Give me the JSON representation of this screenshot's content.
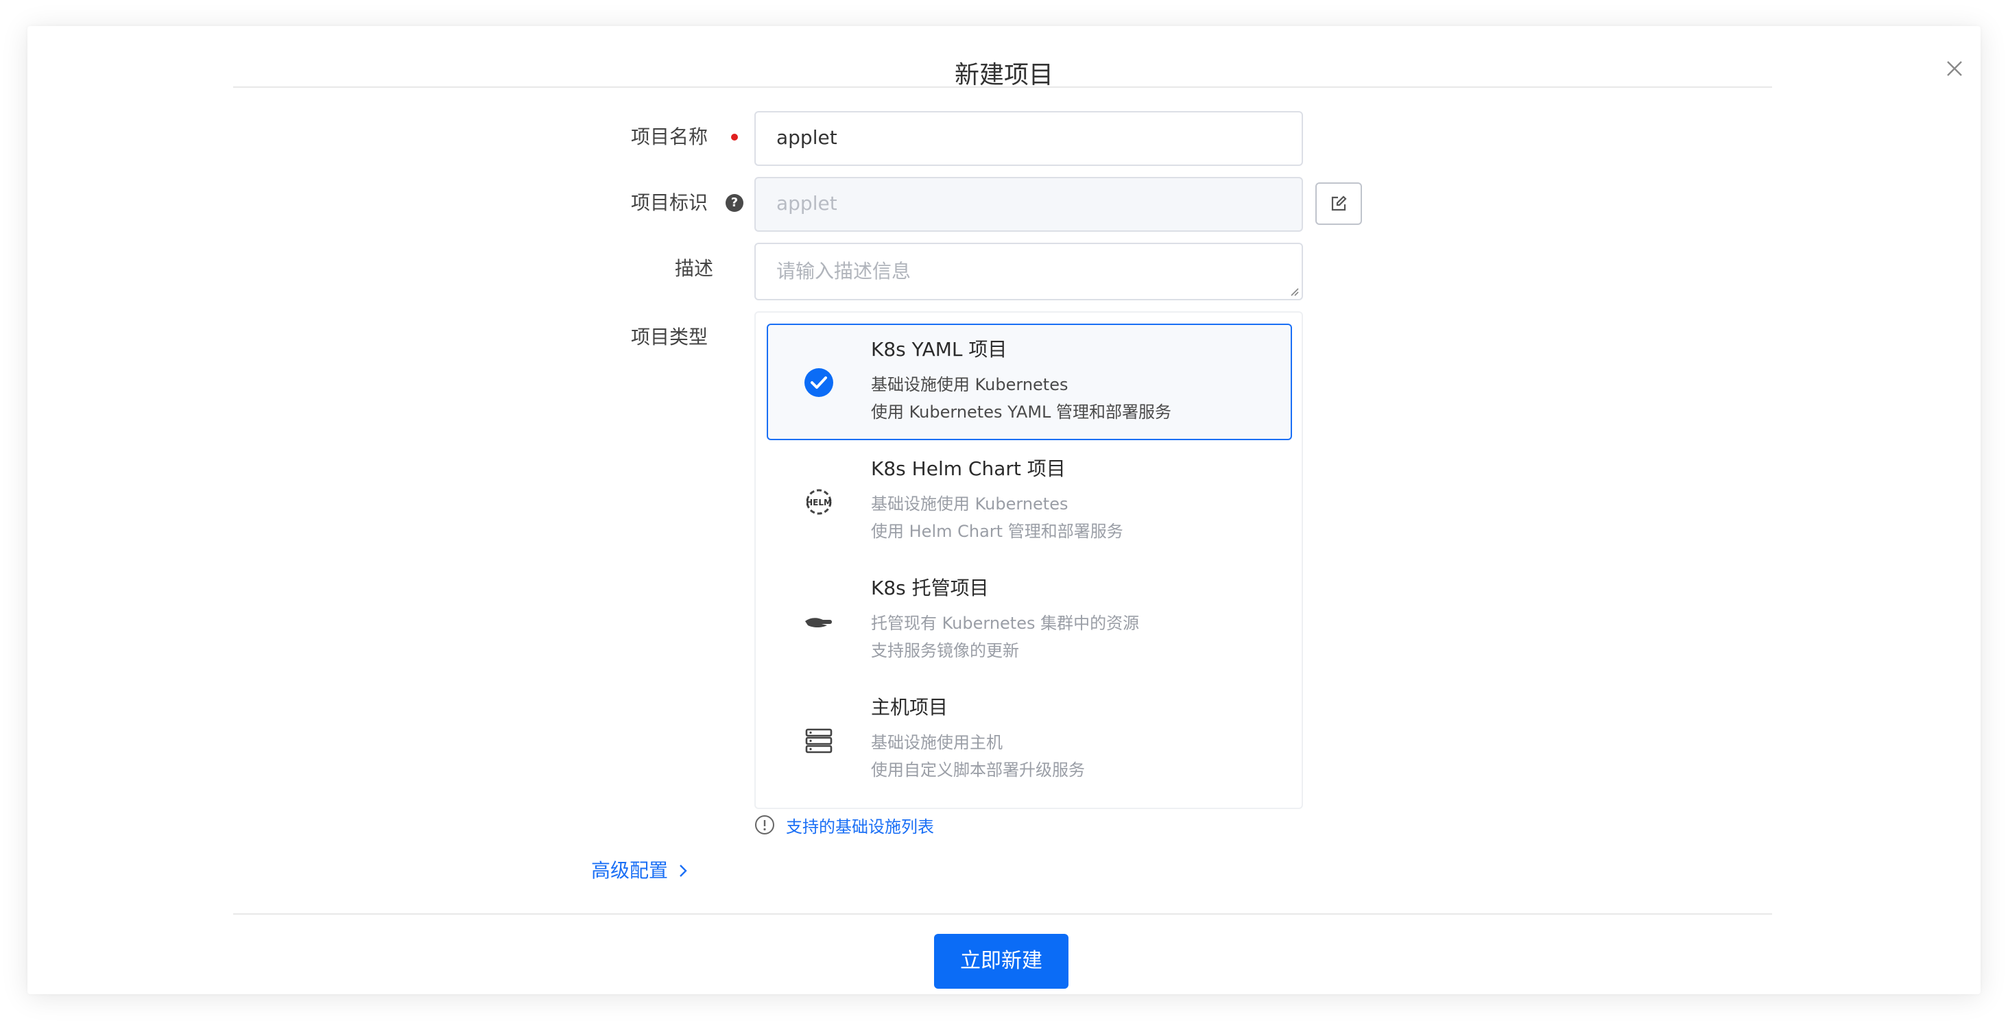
{
  "modal": {
    "title": "新建项目"
  },
  "form": {
    "name": {
      "label": "项目名称",
      "value": "applet"
    },
    "identifier": {
      "label": "项目标识",
      "value": "applet"
    },
    "description": {
      "label": "描述",
      "placeholder": "请输入描述信息"
    },
    "project_type": {
      "label": "项目类型",
      "options": [
        {
          "name": "K8s YAML 项目",
          "line1": "基础设施使用 Kubernetes",
          "line2": "使用 Kubernetes YAML 管理和部署服务",
          "icon": "check-circle-icon",
          "selected": true
        },
        {
          "name": "K8s Helm Chart 项目",
          "line1": "基础设施使用 Kubernetes",
          "line2": "使用 Helm Chart 管理和部署服务",
          "icon": "helm-icon",
          "selected": false
        },
        {
          "name": "K8s 托管项目",
          "line1": "托管现有 Kubernetes 集群中的资源",
          "line2": "支持服务镜像的更新",
          "icon": "hand-icon",
          "selected": false
        },
        {
          "name": "主机项目",
          "line1": "基础设施使用主机",
          "line2": "使用自定义脚本部署升级服务",
          "icon": "server-icon",
          "selected": false
        }
      ]
    },
    "infra_link": "支持的基础设施列表",
    "advanced": "高级配置"
  },
  "footer": {
    "submit_label": "立即新建"
  },
  "colors": {
    "primary": "#0b6cf6",
    "required": "#e02020",
    "border": "#dcdfe6"
  }
}
